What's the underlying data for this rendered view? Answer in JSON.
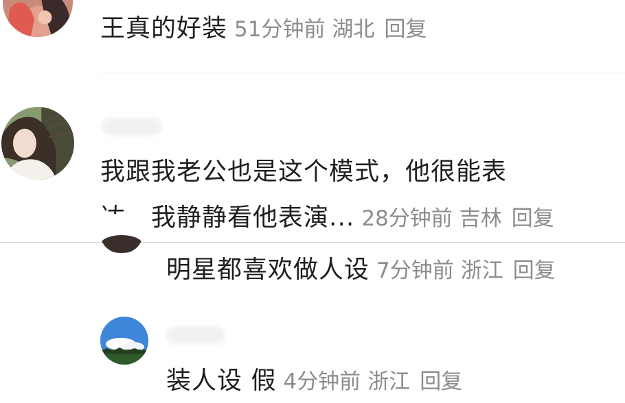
{
  "comments": [
    {
      "text": "王真的好装",
      "time": "51分钟前",
      "location": "湖北",
      "reply": "回复",
      "avatar": "woman-avatar-pink"
    },
    {
      "text_line1": "我跟我老公也是这个模式，他很能表",
      "text_line2": "达，我静静看他表演...",
      "time": "28分钟前",
      "location": "吉林",
      "reply": "回复",
      "avatar": "woman-avatar-windblown-hair"
    },
    {
      "text": "明星都喜欢做人设",
      "time": "7分钟前",
      "location": "浙江",
      "reply": "回复",
      "avatar": "dark-avatar"
    },
    {
      "text": "装人设 假",
      "time": "4分钟前",
      "location": "浙江",
      "reply": "回复",
      "avatar": "sky-landscape-avatar"
    }
  ],
  "colors": {
    "text": "#1f1f1f",
    "meta": "#8c8c8c",
    "divider": "#ececec"
  }
}
